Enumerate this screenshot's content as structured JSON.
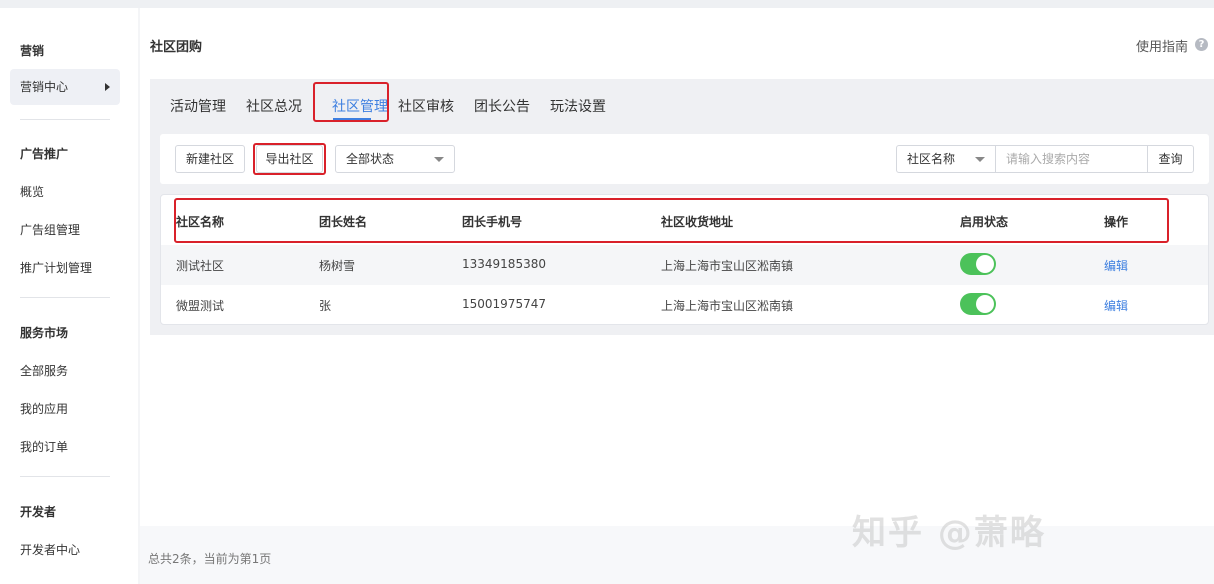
{
  "sidebar": {
    "sections": [
      {
        "title": "营销",
        "items": [
          "营销中心"
        ]
      },
      {
        "title": "广告推广",
        "items": [
          "概览",
          "广告组管理",
          "推广计划管理"
        ]
      },
      {
        "title": "服务市场",
        "items": [
          "全部服务",
          "我的应用",
          "我的订单"
        ]
      },
      {
        "title": "开发者",
        "items": [
          "开发者中心"
        ]
      }
    ]
  },
  "header": {
    "title": "社区团购",
    "help": "使用指南",
    "help_icon": "?"
  },
  "tabs": [
    "活动管理",
    "社区总况",
    "社区管理",
    "社区审核",
    "团长公告",
    "玩法设置"
  ],
  "active_tab": "社区管理",
  "toolbar": {
    "new_button": "新建社区",
    "export_button": "导出社区",
    "status_select": "全部状态",
    "search_field_select": "社区名称",
    "search_placeholder": "请输入搜索内容",
    "query_button": "查询"
  },
  "table": {
    "headers": [
      "社区名称",
      "团长姓名",
      "团长手机号",
      "社区收货地址",
      "启用状态",
      "操作"
    ],
    "rows": [
      {
        "name": "测试社区",
        "leader": "杨树雪",
        "phone": "13349185380",
        "address": "上海上海市宝山区淞南镇",
        "enabled": true,
        "action": "编辑"
      },
      {
        "name": "微盟测试",
        "leader": "张",
        "phone": "15001975747",
        "address": "上海上海市宝山区淞南镇",
        "enabled": true,
        "action": "编辑"
      }
    ]
  },
  "footer": {
    "summary": "总共2条，当前为第1页"
  },
  "watermark": "知乎 @萧略",
  "colors": {
    "accent": "#3d7fe0",
    "highlight": "#d9212a",
    "switch_on": "#4cc25a"
  }
}
